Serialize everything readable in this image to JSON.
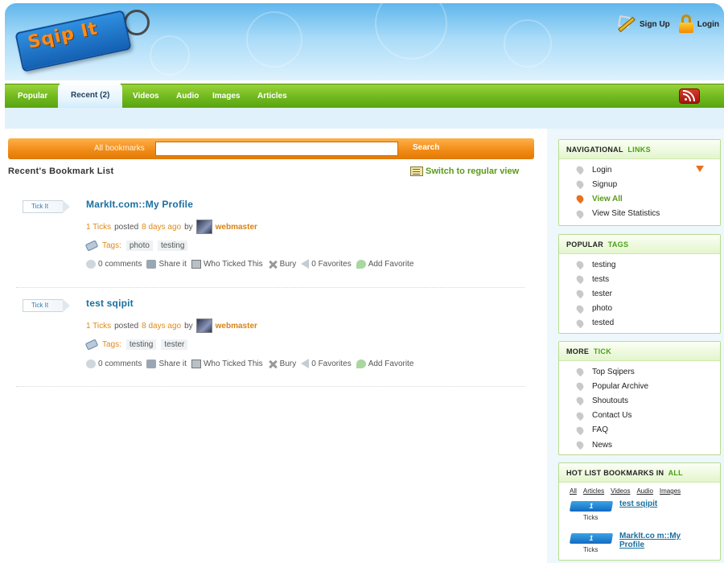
{
  "header": {
    "logo_text": "Sqip It",
    "signup_label": "Sign Up",
    "login_label": "Login"
  },
  "nav": {
    "tabs": [
      {
        "label": "Popular"
      },
      {
        "label": "Recent (2)",
        "active": true
      },
      {
        "label": "Videos"
      },
      {
        "label": "Audio"
      },
      {
        "label": "Images"
      },
      {
        "label": "Articles"
      }
    ]
  },
  "search": {
    "label": "All bookmarks",
    "value": "",
    "button_label": "Search"
  },
  "list": {
    "title": "Recent's Bookmark List",
    "switch_label": "Switch to regular view"
  },
  "bookmarks": [
    {
      "tick_label": "Tick It",
      "title": "MarkIt.com::My Profile",
      "ticks": "1 Ticks",
      "posted": "posted",
      "ago": "8 days ago",
      "by": "by",
      "user": "webmaster",
      "tags_label": "Tags:",
      "tags": [
        "photo",
        "testing"
      ],
      "actions": {
        "comments": "0 comments",
        "share": "Share it",
        "who": "Who Ticked This",
        "bury": "Bury",
        "favorites": "0 Favorites",
        "add_fav": "Add Favorite"
      }
    },
    {
      "tick_label": "Tick It",
      "title": "test sqipit",
      "ticks": "1 Ticks",
      "posted": "posted",
      "ago": "8 days ago",
      "by": "by",
      "user": "webmaster",
      "tags_label": "Tags:",
      "tags": [
        "testing",
        "tester"
      ],
      "actions": {
        "comments": "0 comments",
        "share": "Share it",
        "who": "Who Ticked This",
        "bury": "Bury",
        "favorites": "0 Favorites",
        "add_fav": "Add Favorite"
      }
    }
  ],
  "sidebar": {
    "navigational": {
      "title_a": "NAVIGATIONAL",
      "title_b": "LINKS",
      "items": [
        "Login",
        "Signup",
        "View All",
        "View Site Statistics"
      ]
    },
    "popular_tags": {
      "title_a": "POPULAR",
      "title_b": "TAGS",
      "items": [
        "testing",
        "tests",
        "tester",
        "photo",
        "tested"
      ]
    },
    "more_tick": {
      "title_a": "MORE",
      "title_b": "TICK",
      "items": [
        "Top Sqipers",
        "Popular Archive",
        "Shoutouts",
        "Contact Us",
        "FAQ",
        "News"
      ]
    },
    "hot_list": {
      "title_a": "HOT LIST BOOKMARKS IN",
      "title_b": "ALL",
      "tabs": [
        "All",
        "Articles",
        "Videos",
        "Audio",
        "Images"
      ],
      "items": [
        {
          "count": "1",
          "ticks_label": "Ticks",
          "title": "test sqipit"
        },
        {
          "count": "1",
          "ticks_label": "Ticks",
          "title": "MarkIt.co m::My Profile"
        }
      ]
    }
  },
  "colors": {
    "nav_green": "#6fb81e",
    "search_orange": "#f08a14",
    "link_blue": "#1a6fa0",
    "accent_green": "#4aa014"
  }
}
